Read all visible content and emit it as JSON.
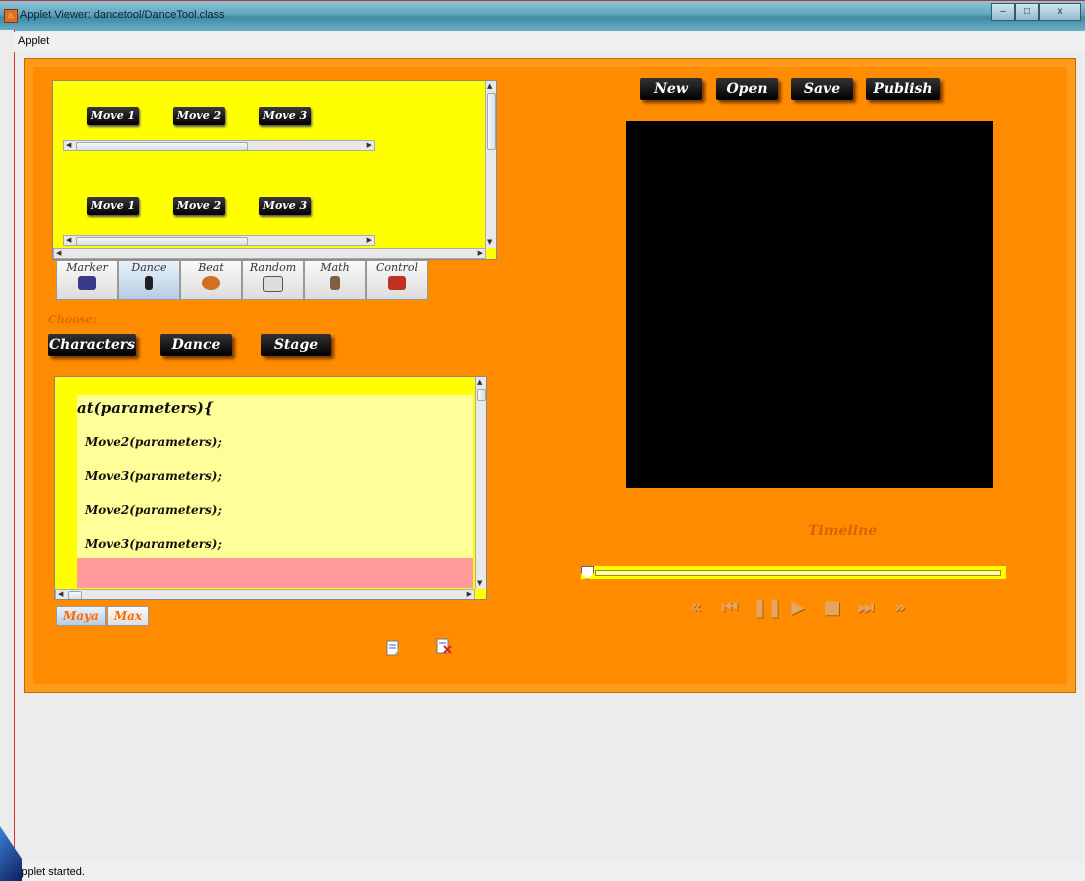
{
  "window": {
    "title": "Applet Viewer: dancetool/DanceTool.class",
    "min_label": "–",
    "max_label": "□",
    "close_label": "x"
  },
  "menu": {
    "applet": "Applet"
  },
  "moves_top": [
    "Move 1",
    "Move 2",
    "Move 3"
  ],
  "moves_bottom": [
    "Move 1",
    "Move 2",
    "Move 3"
  ],
  "tabs": [
    {
      "label": "Marker",
      "color": "#3a3a8a"
    },
    {
      "label": "Dance",
      "color": "#202020"
    },
    {
      "label": "Beat",
      "color": "#d07020"
    },
    {
      "label": "Random",
      "color": "#dddddd"
    },
    {
      "label": "Math",
      "color": "#806040"
    },
    {
      "label": "Control",
      "color": "#c03020"
    }
  ],
  "choose_label": "Choose:",
  "choose_buttons": [
    "Characters",
    "Dance",
    "Stage"
  ],
  "code": {
    "header": "at(parameters){",
    "lines": [
      "Move2(parameters);",
      "Move3(parameters);",
      "Move2(parameters);",
      "Move3(parameters);"
    ]
  },
  "bottom_tabs": [
    "Maya",
    "Max"
  ],
  "file_buttons": [
    "New",
    "Open",
    "Save",
    "Publish"
  ],
  "timeline_label": "Timeline",
  "timeline_position": 0,
  "controls": [
    "«",
    "⏮",
    "❚❚",
    "▶",
    "■",
    "⏭",
    "»"
  ],
  "status": "Applet started.",
  "colors": {
    "applet_bg": "#ff8c00",
    "panel_yellow": "#ffff00",
    "code_bg": "#ffff99",
    "highlight": "#ff9a9a"
  }
}
